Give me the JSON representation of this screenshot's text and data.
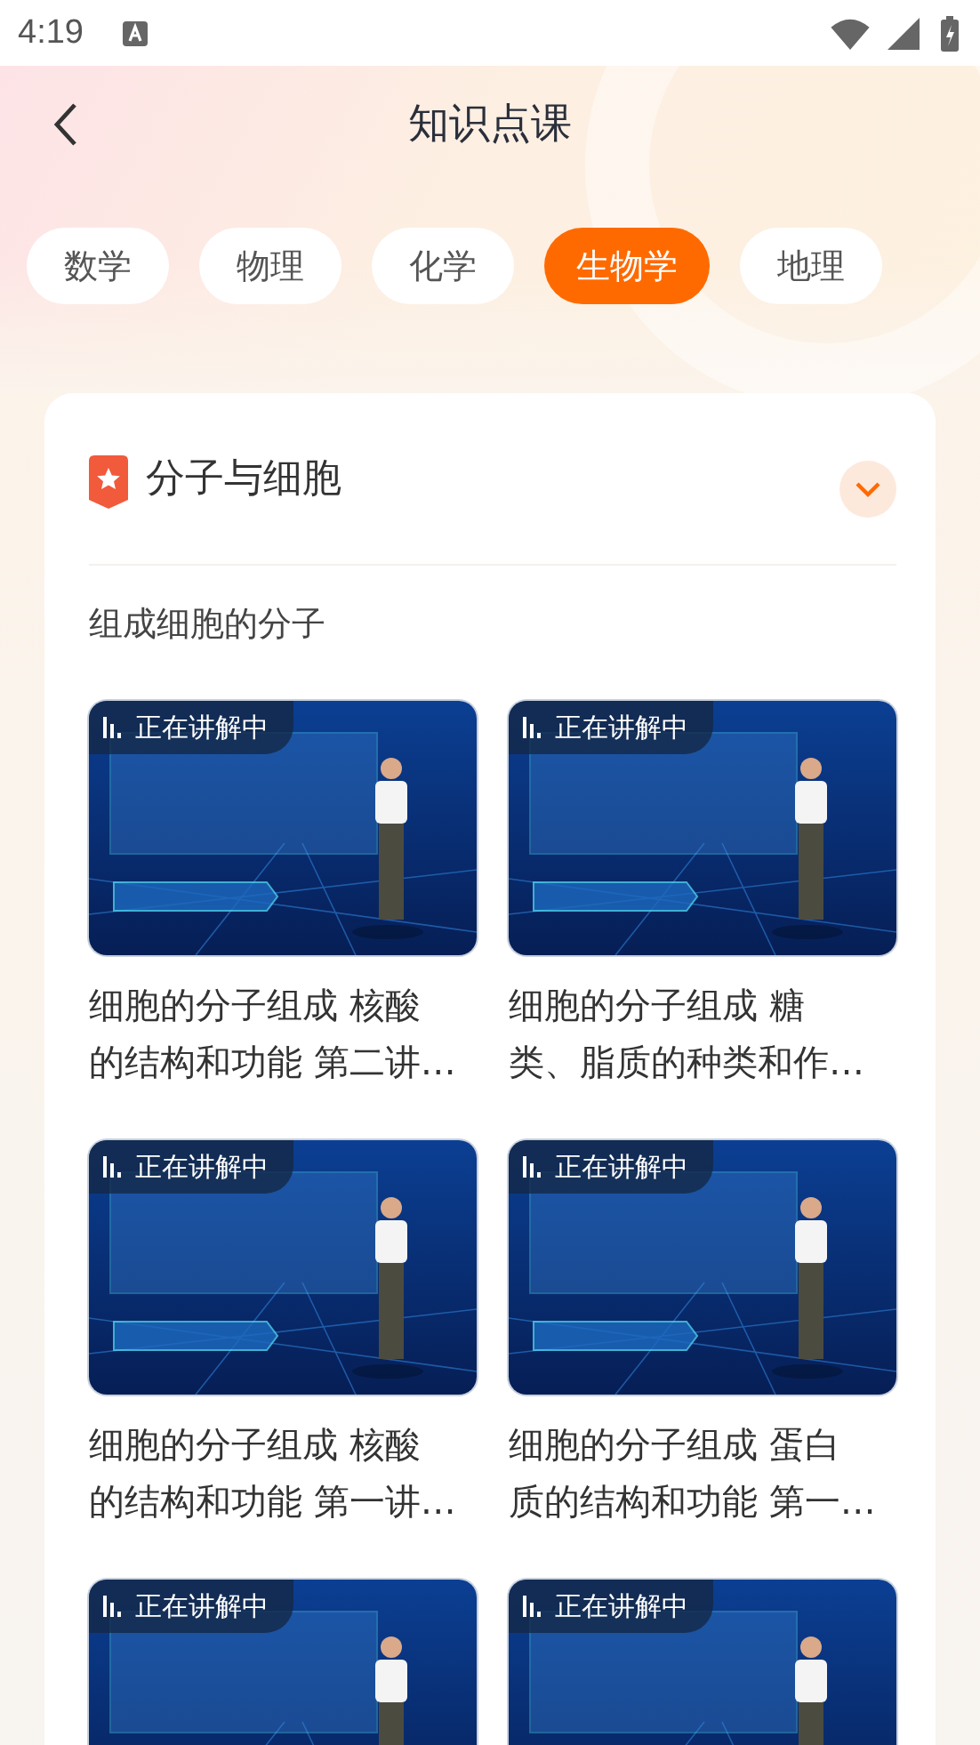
{
  "status_bar": {
    "time": "4:19"
  },
  "header": {
    "title": "知识点课"
  },
  "tabs": [
    {
      "label": "数学",
      "selected": false
    },
    {
      "label": "物理",
      "selected": false
    },
    {
      "label": "化学",
      "selected": false
    },
    {
      "label": "生物学",
      "selected": true
    },
    {
      "label": "地理",
      "selected": false
    }
  ],
  "section": {
    "title": "分子与细胞",
    "subtitle": "组成细胞的分子",
    "videos": [
      {
        "badge": "正在讲解中",
        "title_lines": [
          "细胞的分子组成 核酸",
          "的结构和功能 第二讲…"
        ]
      },
      {
        "badge": "正在讲解中",
        "title_lines": [
          "细胞的分子组成 糖",
          "类、脂质的种类和作…"
        ]
      },
      {
        "badge": "正在讲解中",
        "title_lines": [
          "细胞的分子组成 核酸",
          "的结构和功能 第一讲…"
        ]
      },
      {
        "badge": "正在讲解中",
        "title_lines": [
          "细胞的分子组成 蛋白",
          "质的结构和功能 第一…"
        ]
      },
      {
        "badge": "正在讲解中"
      },
      {
        "badge": "正在讲解中"
      }
    ]
  }
}
